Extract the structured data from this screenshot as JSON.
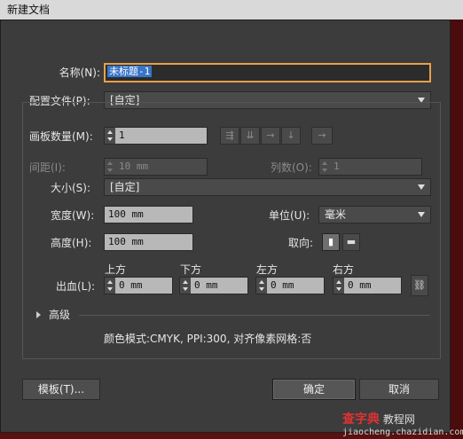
{
  "window": {
    "title": "新建文档"
  },
  "name": {
    "label": "名称(N):",
    "value": "未标题-1"
  },
  "profile": {
    "label": "配置文件(P):",
    "value": "[自定]"
  },
  "artboards": {
    "count_label": "画板数量(M):",
    "count_value": "1",
    "layout_icons": [
      "grid-by-row-icon",
      "grid-by-column-icon",
      "arrange-by-row-icon",
      "arrange-by-column-icon",
      "right-to-left-icon"
    ],
    "spacing_label": "间距(I):",
    "spacing_value": "10 mm",
    "columns_label": "列数(O):",
    "columns_value": "1"
  },
  "size": {
    "label": "大小(S):",
    "value": "[自定]"
  },
  "width": {
    "label": "宽度(W):",
    "value": "100 mm"
  },
  "units": {
    "label": "单位(U):",
    "value": "毫米"
  },
  "height": {
    "label": "高度(H):",
    "value": "100 mm"
  },
  "orientation": {
    "label": "取向:",
    "portrait_icon": "portrait-icon",
    "landscape_icon": "landscape-icon"
  },
  "bleed": {
    "label": "出血(L):",
    "top_label": "上方",
    "top_value": "0 mm",
    "bottom_label": "下方",
    "bottom_value": "0 mm",
    "left_label": "左方",
    "left_value": "0 mm",
    "right_label": "右方",
    "right_value": "0 mm",
    "link_icon": "chain-link-icon"
  },
  "advanced": {
    "label": "高级"
  },
  "summary": "颜色模式:CMYK, PPI:300, 对齐像素网格:否",
  "buttons": {
    "templates": "模板(T)...",
    "ok": "确定",
    "cancel": "取消"
  },
  "watermark": {
    "brand": "查字典",
    "sub": "教程网",
    "url": "jiaocheng.chazidian.com"
  },
  "colors": {
    "focus": "#e8a04a",
    "selection": "#3874c8",
    "dialog_bg": "#3c3c3c"
  }
}
